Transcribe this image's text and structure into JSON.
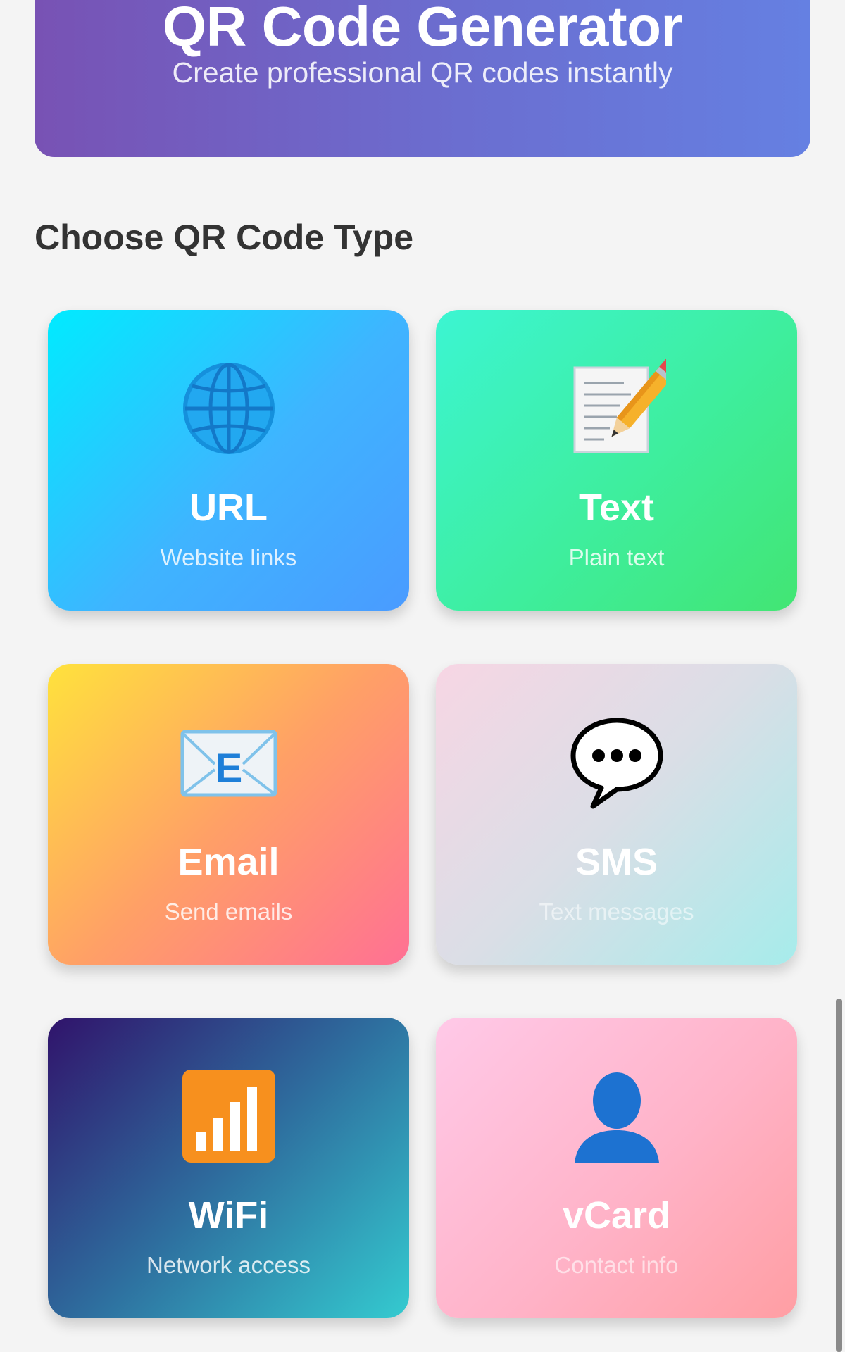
{
  "header": {
    "title": "QR Code Generator",
    "subtitle": "Create professional QR codes instantly"
  },
  "section": {
    "title": "Choose QR Code Type"
  },
  "cards": [
    {
      "label": "URL",
      "description": "Website links",
      "icon": "globe-icon"
    },
    {
      "label": "Text",
      "description": "Plain text",
      "icon": "memo-pencil-icon"
    },
    {
      "label": "Email",
      "description": "Send emails",
      "icon": "email-envelope-icon"
    },
    {
      "label": "SMS",
      "description": "Text messages",
      "icon": "speech-bubble-icon"
    },
    {
      "label": "WiFi",
      "description": "Network access",
      "icon": "signal-bars-icon"
    },
    {
      "label": "vCard",
      "description": "Contact info",
      "icon": "person-silhouette-icon"
    }
  ],
  "colors": {
    "header_gradient": [
      "#7852b4",
      "#6580e2"
    ],
    "background": "#f4f4f4",
    "url_card": [
      "#00ebff",
      "#4a9bff"
    ],
    "text_card": [
      "#3cf5d2",
      "#42e573"
    ],
    "email_card": [
      "#ffe23c",
      "#ff7094"
    ],
    "sms_card": [
      "#f7d6e4",
      "#a6eceb"
    ],
    "wifi_card": [
      "#30136b",
      "#34cbd0"
    ],
    "vcard_card": [
      "#ffc9e8",
      "#ff9ea3"
    ]
  }
}
